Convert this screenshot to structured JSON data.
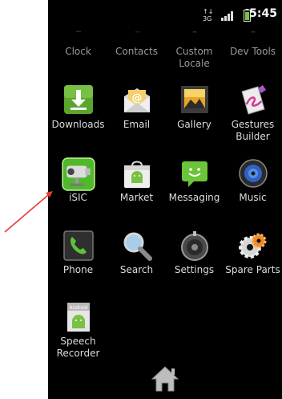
{
  "status_bar": {
    "data_indicator": "3G",
    "time": "5:45",
    "icons": [
      "data-3g-icon",
      "signal-icon",
      "battery-icon"
    ]
  },
  "apps": [
    {
      "label": "Clock",
      "icon": "clock-icon"
    },
    {
      "label": "Contacts",
      "icon": "contacts-icon"
    },
    {
      "label": "Custom Locale",
      "icon": "custom-locale-icon"
    },
    {
      "label": "Dev Tools",
      "icon": "dev-tools-icon"
    },
    {
      "label": "Downloads",
      "icon": "downloads-icon"
    },
    {
      "label": "Email",
      "icon": "email-icon"
    },
    {
      "label": "Gallery",
      "icon": "gallery-icon"
    },
    {
      "label": "Gestures Builder",
      "icon": "gestures-builder-icon"
    },
    {
      "label": "iSIC",
      "icon": "isic-icon"
    },
    {
      "label": "Market",
      "icon": "market-icon"
    },
    {
      "label": "Messaging",
      "icon": "messaging-icon"
    },
    {
      "label": "Music",
      "icon": "music-icon"
    },
    {
      "label": "Phone",
      "icon": "phone-icon"
    },
    {
      "label": "Search",
      "icon": "search-icon"
    },
    {
      "label": "Settings",
      "icon": "settings-icon"
    },
    {
      "label": "Spare Parts",
      "icon": "spare-parts-icon"
    },
    {
      "label": "Speech Recorder",
      "icon": "speech-recorder-icon"
    }
  ],
  "icon_badges": {
    "speech_recorder": "Android",
    "email": "@"
  },
  "home_button": {
    "icon": "home-icon"
  },
  "annotation": {
    "arrow_color": "#e53935"
  }
}
